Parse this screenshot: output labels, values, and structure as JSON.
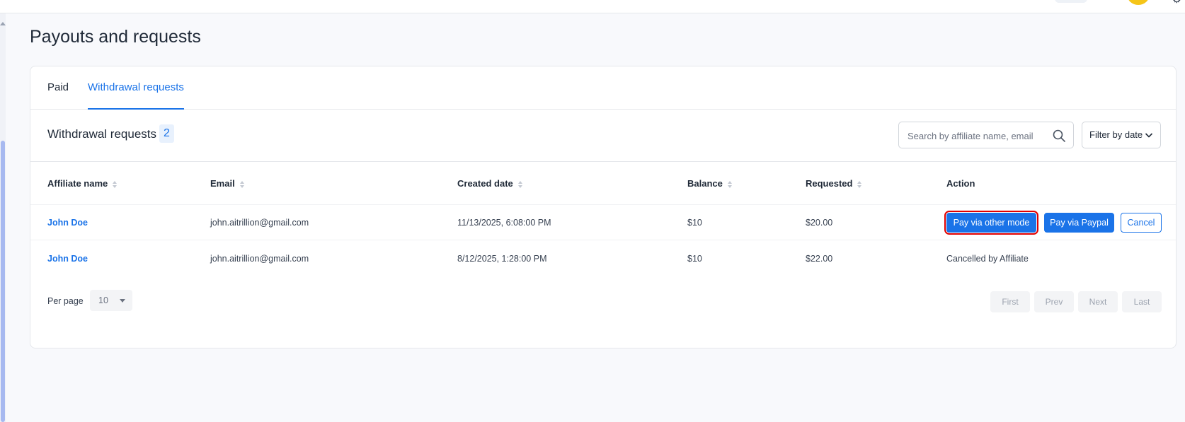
{
  "page": {
    "title": "Payouts and requests"
  },
  "tabs": [
    {
      "label": "Paid",
      "active": false
    },
    {
      "label": "Withdrawal requests",
      "active": true
    }
  ],
  "section": {
    "title": "Withdrawal requests",
    "count": "2",
    "search_placeholder": "Search by affiliate name, email",
    "filter_label": "Filter by date"
  },
  "table": {
    "columns": [
      "Affiliate name",
      "Email",
      "Created date",
      "Balance",
      "Requested",
      "Action"
    ],
    "rows": [
      {
        "name": "John Doe",
        "email": "john.aitrillion@gmail.com",
        "created": "11/13/2025, 6:08:00 PM",
        "balance": "$10",
        "requested": "$20.00",
        "actions": [
          "Pay via other mode",
          "Pay via Paypal",
          "Cancel"
        ]
      },
      {
        "name": "John Doe",
        "email": "john.aitrillion@gmail.com",
        "created": "8/12/2025, 1:28:00 PM",
        "balance": "$10",
        "requested": "$22.00",
        "status": "Cancelled by Affiliate"
      }
    ]
  },
  "pagination": {
    "per_page_label": "Per page",
    "per_page_value": "10",
    "buttons": [
      "First",
      "Prev",
      "Next",
      "Last"
    ]
  },
  "colors": {
    "accent": "#1a73e8",
    "highlight_outline": "#e00000",
    "avatar": "#f5c518"
  },
  "icons": {
    "search": "search-icon",
    "filter": "chevron-down-icon",
    "sort": "sort-icon",
    "gear": "gear-icon"
  }
}
